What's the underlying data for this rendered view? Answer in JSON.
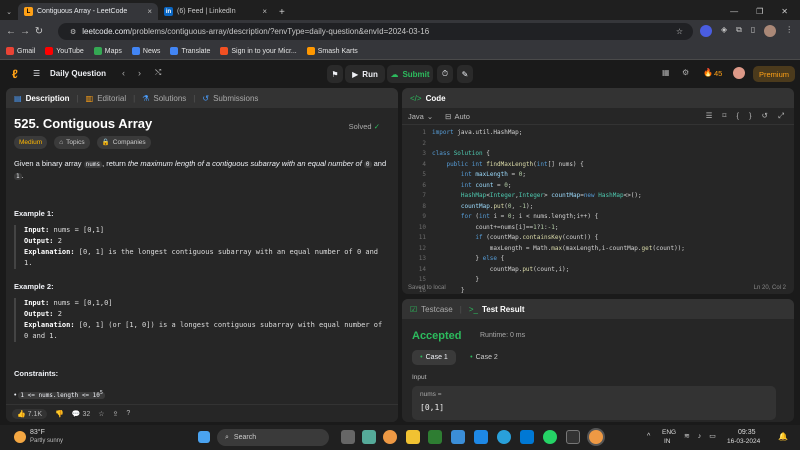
{
  "browser": {
    "tabs": [
      {
        "title": "Contiguous Array - LeetCode"
      },
      {
        "title": "(6) Feed | LinkedIn"
      }
    ],
    "new_tab": "+",
    "url_domain": "leetcode.com",
    "url_path": "/problems/contiguous-array/description/?envType=daily-question&envId=2024-03-16"
  },
  "bookmarks": [
    {
      "label": "Gmail",
      "color": "#ea4335"
    },
    {
      "label": "YouTube",
      "color": "#ff0000"
    },
    {
      "label": "Maps",
      "color": "#34a853"
    },
    {
      "label": "News",
      "color": "#4285f4"
    },
    {
      "label": "Translate",
      "color": "#4285f4"
    },
    {
      "label": "Sign in to your Micr...",
      "color": "#f25022"
    },
    {
      "label": "Smash Karts",
      "color": "#ff9800"
    }
  ],
  "header": {
    "daily": "Daily Question",
    "run": "Run",
    "submit": "Submit",
    "streak": "45",
    "premium": "Premium"
  },
  "desc": {
    "tabs": [
      "Description",
      "Editorial",
      "Solutions",
      "Submissions"
    ],
    "title": "525. Contiguous Array",
    "solved": "Solved",
    "difficulty": "Medium",
    "topics": "Topics",
    "companies": "Companies",
    "statement_pre": "Given a binary array ",
    "nums": "nums",
    "statement_mid": ", return ",
    "statement_em": "the maximum length of a contiguous subarray with an equal number of ",
    "zero": "0",
    "and": " and ",
    "one": "1",
    "dot": ".",
    "ex1_title": "Example 1:",
    "ex1_input": "nums = [0,1]",
    "ex1_output": "2",
    "ex1_expl": "[0, 1] is the longest contiguous subarray with an equal number of 0 and 1.",
    "ex2_title": "Example 2:",
    "ex2_input": "nums = [0,1,0]",
    "ex2_output": "2",
    "ex2_expl": "[0, 1] (or [1, 0]) is a longest contiguous subarray with equal number of 0 and 1.",
    "input_label": "Input:",
    "output_label": "Output:",
    "expl_label": "Explanation:",
    "constraints_title": "Constraints:",
    "constraint1": "1 <= nums.length <= 10",
    "sup": "5",
    "likes": "7.1K",
    "comments": "32"
  },
  "code": {
    "title": "Code",
    "lang": "Java",
    "auto": "Auto",
    "saved": "Saved to local",
    "pos": "Ln 20, Col 2"
  },
  "result": {
    "tab1": "Testcase",
    "tab2": "Test Result",
    "status": "Accepted",
    "runtime": "Runtime: 0 ms",
    "case1": "Case 1",
    "case2": "Case 2",
    "input": "Input",
    "var": "nums =",
    "val": "[0,1]"
  },
  "taskbar": {
    "temp": "83°F",
    "weather": "Partly sunny",
    "search": "Search",
    "lang1": "ENG",
    "lang2": "IN",
    "time": "09:35",
    "date": "16-03-2024"
  }
}
